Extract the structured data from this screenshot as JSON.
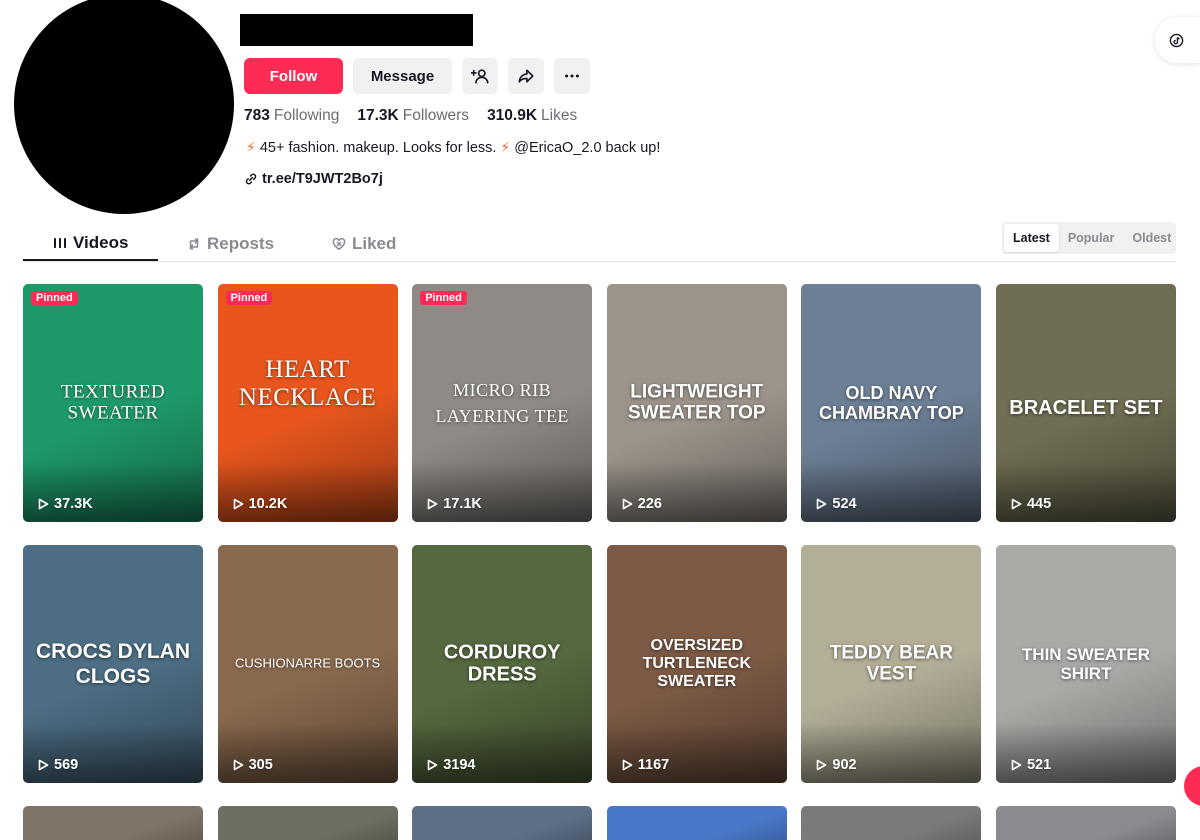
{
  "profile": {
    "actions": {
      "follow_label": "Follow",
      "message_label": "Message",
      "add_friend_icon": "add-user-icon",
      "share_icon": "share-icon",
      "more_icon": "more-icon"
    },
    "stats": {
      "following_count": "783",
      "following_label": "Following",
      "followers_count": "17.3K",
      "followers_label": "Followers",
      "likes_count": "310.9K",
      "likes_label": "Likes"
    },
    "bio": {
      "text_before": "45+ fashion. makeup. Looks for less.",
      "text_after": "@EricaO_2.0 back up!"
    },
    "link": "tr.ee/T9JWT2Bo7j"
  },
  "tabs": [
    {
      "label": "Videos",
      "icon": "grid-icon"
    },
    {
      "label": "Reposts",
      "icon": "repost-icon"
    },
    {
      "label": "Liked",
      "icon": "heart-icon"
    }
  ],
  "sort": [
    {
      "label": "Latest"
    },
    {
      "label": "Popular"
    },
    {
      "label": "Oldest"
    }
  ],
  "colors": {
    "accent": "#fe2c55",
    "flash_icon": "#f6662a"
  },
  "videos": [
    {
      "title": "TEXTURED SWEATER",
      "views": "37.3K",
      "pinned": "Pinned",
      "bg": "#1e9a6a"
    },
    {
      "title": "HEART NECKLACE",
      "views": "10.2K",
      "pinned": "Pinned",
      "bg": "#e8561e"
    },
    {
      "title": "MICRO RIB LAYERING TEE",
      "views": "17.1K",
      "pinned": "Pinned",
      "bg": "#8f8a85"
    },
    {
      "title": "LIGHTWEIGHT SWEATER TOP",
      "views": "226",
      "bg": "#9c948b"
    },
    {
      "title": "OLD NAVY CHAMBRAY TOP",
      "views": "524",
      "bg": "#6d7f95"
    },
    {
      "title": "BRACELET SET",
      "views": "445",
      "bg": "#6f6d52"
    },
    {
      "title": "CROCS DYLAN CLOGS",
      "views": "569",
      "bg": "#4d6e84"
    },
    {
      "title": "CUSHIONARRE BOOTS",
      "views": "305",
      "bg": "#8a6a4e"
    },
    {
      "title": "CORDUROY DRESS",
      "views": "3194",
      "bg": "#55683f"
    },
    {
      "title": "OVERSIZED TURTLENECK SWEATER",
      "views": "1167",
      "bg": "#7c5a45"
    },
    {
      "title": "TEDDY BEAR VEST",
      "views": "902",
      "bg": "#b3ae98"
    },
    {
      "title": "THIN SWEATER SHIRT",
      "views": "521",
      "bg": "#a9aaa6"
    },
    {
      "title": "",
      "views": "",
      "bg": "#7f7466"
    },
    {
      "title": "",
      "views": "",
      "bg": "#6e6f60"
    },
    {
      "title": "",
      "views": "",
      "bg": "#5d6f86"
    },
    {
      "title": "",
      "views": "",
      "bg": "#4a78c8"
    },
    {
      "title": "",
      "views": "",
      "bg": "#7c7a78"
    },
    {
      "title": "",
      "views": "",
      "bg": "#898b90"
    }
  ]
}
